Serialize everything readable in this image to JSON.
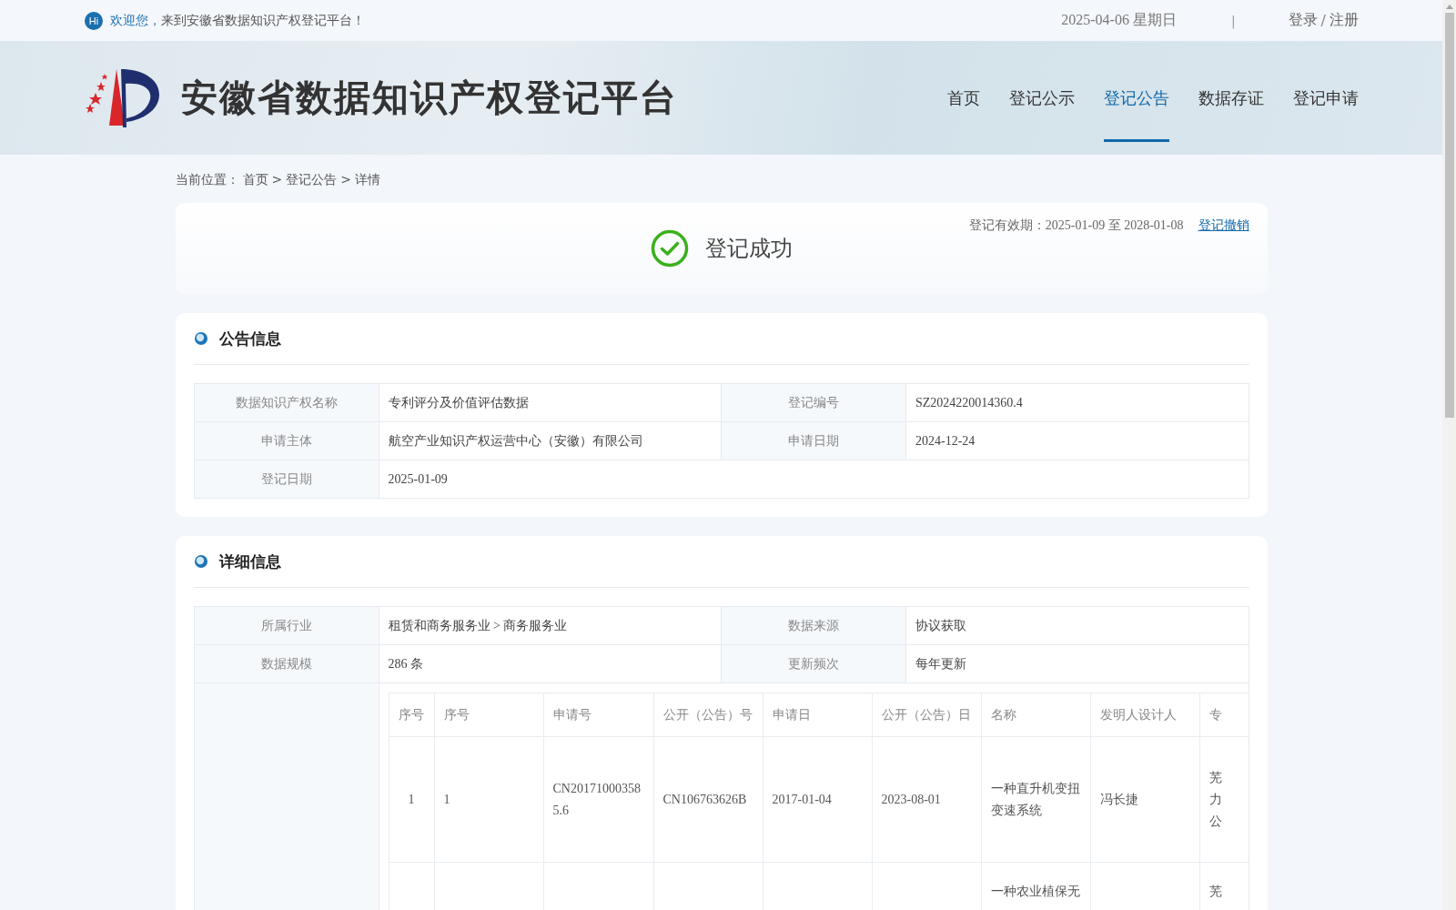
{
  "topbar": {
    "hi": "Hi",
    "greeting": "欢迎您，",
    "welcome": "来到安徽省数据知识产权登记平台！",
    "date": "2025-04-06 星期日",
    "separator": "|",
    "login": "登录",
    "slash": "/",
    "register": "注册"
  },
  "header": {
    "title": "安徽省数据知识产权登记平台"
  },
  "nav": [
    {
      "label": "首页",
      "selected": false
    },
    {
      "label": "登记公示",
      "selected": false
    },
    {
      "label": "登记公告",
      "selected": true
    },
    {
      "label": "数据存证",
      "selected": false
    },
    {
      "label": "登记申请",
      "selected": false
    }
  ],
  "breadcrumb": {
    "label": "当前位置：",
    "separator": ">",
    "items": [
      "首页",
      "登记公告",
      "详情"
    ]
  },
  "status": {
    "title": "登记成功",
    "validity_label": "登记有效期：",
    "validity": "2025-01-09 至 2028-01-08",
    "revoke": "登记撤销"
  },
  "announcement": {
    "title": "公告信息",
    "rows": [
      [
        {
          "label": "数据知识产权名称",
          "value": "专利评分及价值评估数据"
        },
        {
          "label": "登记编号",
          "value": "SZ2024220014360.4"
        }
      ],
      [
        {
          "label": "申请主体",
          "value": "航空产业知识产权运营中心（安徽）有限公司"
        },
        {
          "label": "申请日期",
          "value": "2024-12-24"
        }
      ],
      [
        {
          "label": "登记日期",
          "value": "2025-01-09"
        }
      ]
    ]
  },
  "details": {
    "title": "详细信息",
    "rows": [
      [
        {
          "label": "所属行业",
          "value": "租赁和商务服务业 > 商务服务业"
        },
        {
          "label": "数据来源",
          "value": "协议获取"
        }
      ],
      [
        {
          "label": "数据规模",
          "value": "286 条"
        },
        {
          "label": "更新频次",
          "value": "每年更新"
        }
      ]
    ],
    "data_table": {
      "columns": [
        "序号",
        "序号",
        "申请号",
        "公开（公告）号",
        "申请日",
        "公开（公告）日",
        "名称",
        "发明人设计人",
        "专"
      ],
      "rows": [
        [
          "1",
          "1",
          "CN201710003585.6",
          "CN106763626B",
          "2017-01-04",
          "2023-08-01",
          "一种直升机变扭变速系统",
          "冯长捷",
          "芜力公"
        ],
        [
          "",
          "",
          "",
          "",
          "",
          "",
          "一种农业植保无",
          "",
          "芜"
        ]
      ]
    }
  }
}
